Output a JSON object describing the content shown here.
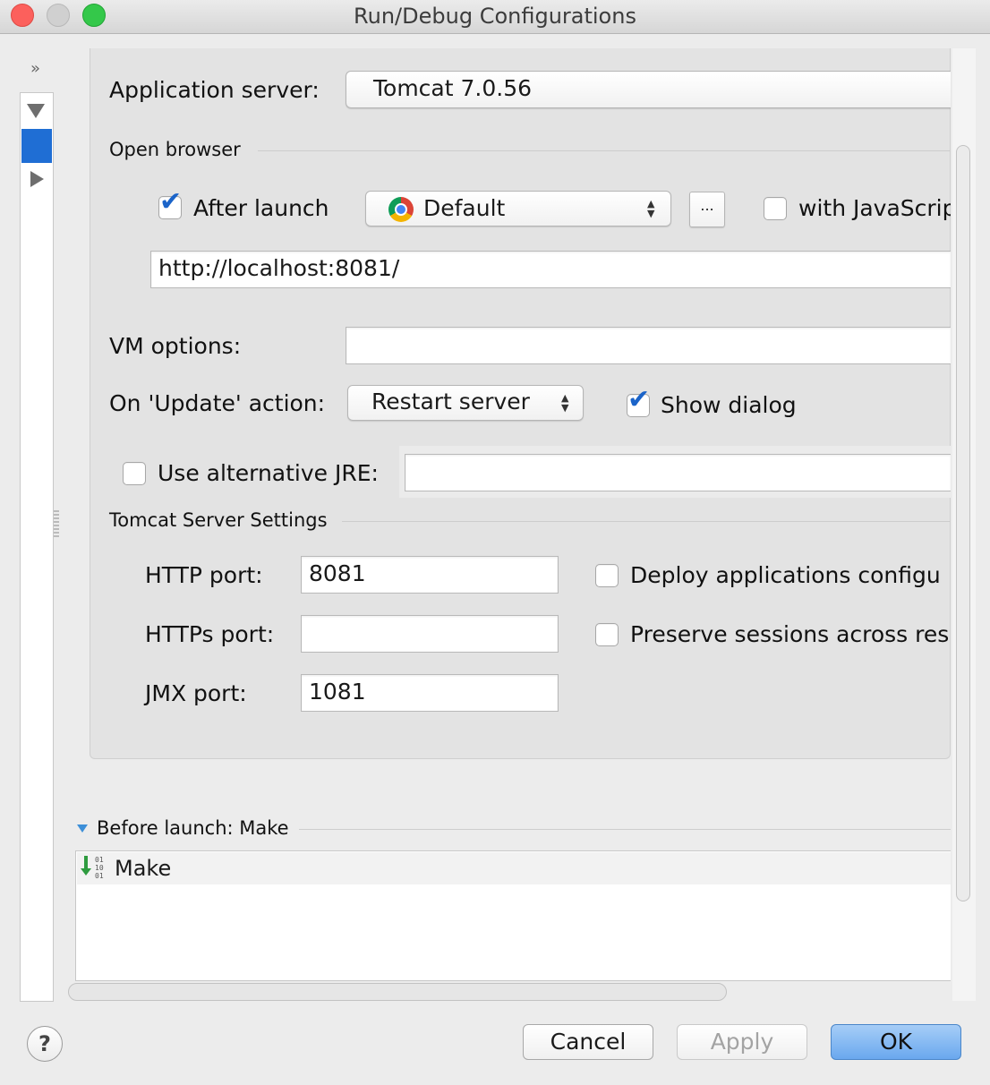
{
  "window": {
    "title": "Run/Debug Configurations",
    "traffic_colors": {
      "close": "#fc605c",
      "minimize": "#d0d0d0",
      "zoom": "#34c84a"
    }
  },
  "app_server": {
    "label": "Application server:",
    "value": "Tomcat 7.0.56"
  },
  "open_browser": {
    "section_label": "Open browser",
    "after_launch": {
      "label": "After launch",
      "checked": true
    },
    "browser_select": {
      "value": "Default",
      "icon": "chrome-icon"
    },
    "ellipsis_label": "...",
    "with_js": {
      "label": "with JavaScrip",
      "checked": false
    },
    "url": "http://localhost:8081/"
  },
  "vm_options": {
    "label": "VM options:",
    "value": ""
  },
  "update_action": {
    "label": "On 'Update' action:",
    "value": "Restart server",
    "show_dialog": {
      "label": "Show dialog",
      "checked": true
    }
  },
  "alt_jre": {
    "label": "Use alternative JRE:",
    "checked": false,
    "value": ""
  },
  "tomcat_settings": {
    "section_label": "Tomcat Server Settings",
    "http_port": {
      "label": "HTTP port:",
      "value": "8081"
    },
    "https_port": {
      "label": "HTTPs port:",
      "value": ""
    },
    "jmx_port": {
      "label": "JMX port:",
      "value": "1081"
    },
    "deploy_apps": {
      "label": "Deploy applications configu",
      "checked": false
    },
    "preserve_sessions": {
      "label": "Preserve sessions across res",
      "checked": false
    }
  },
  "before_launch": {
    "label": "Before launch: Make",
    "items": [
      {
        "label": "Make",
        "icon": "make-icon"
      }
    ]
  },
  "left_panel": {
    "chevron": "»"
  },
  "buttons": {
    "help": "?",
    "cancel": "Cancel",
    "apply": "Apply",
    "ok": "OK"
  },
  "colors": {
    "accent": "#1f6ed4",
    "ok_button": "#78aff0",
    "check": "#1b64c9"
  }
}
